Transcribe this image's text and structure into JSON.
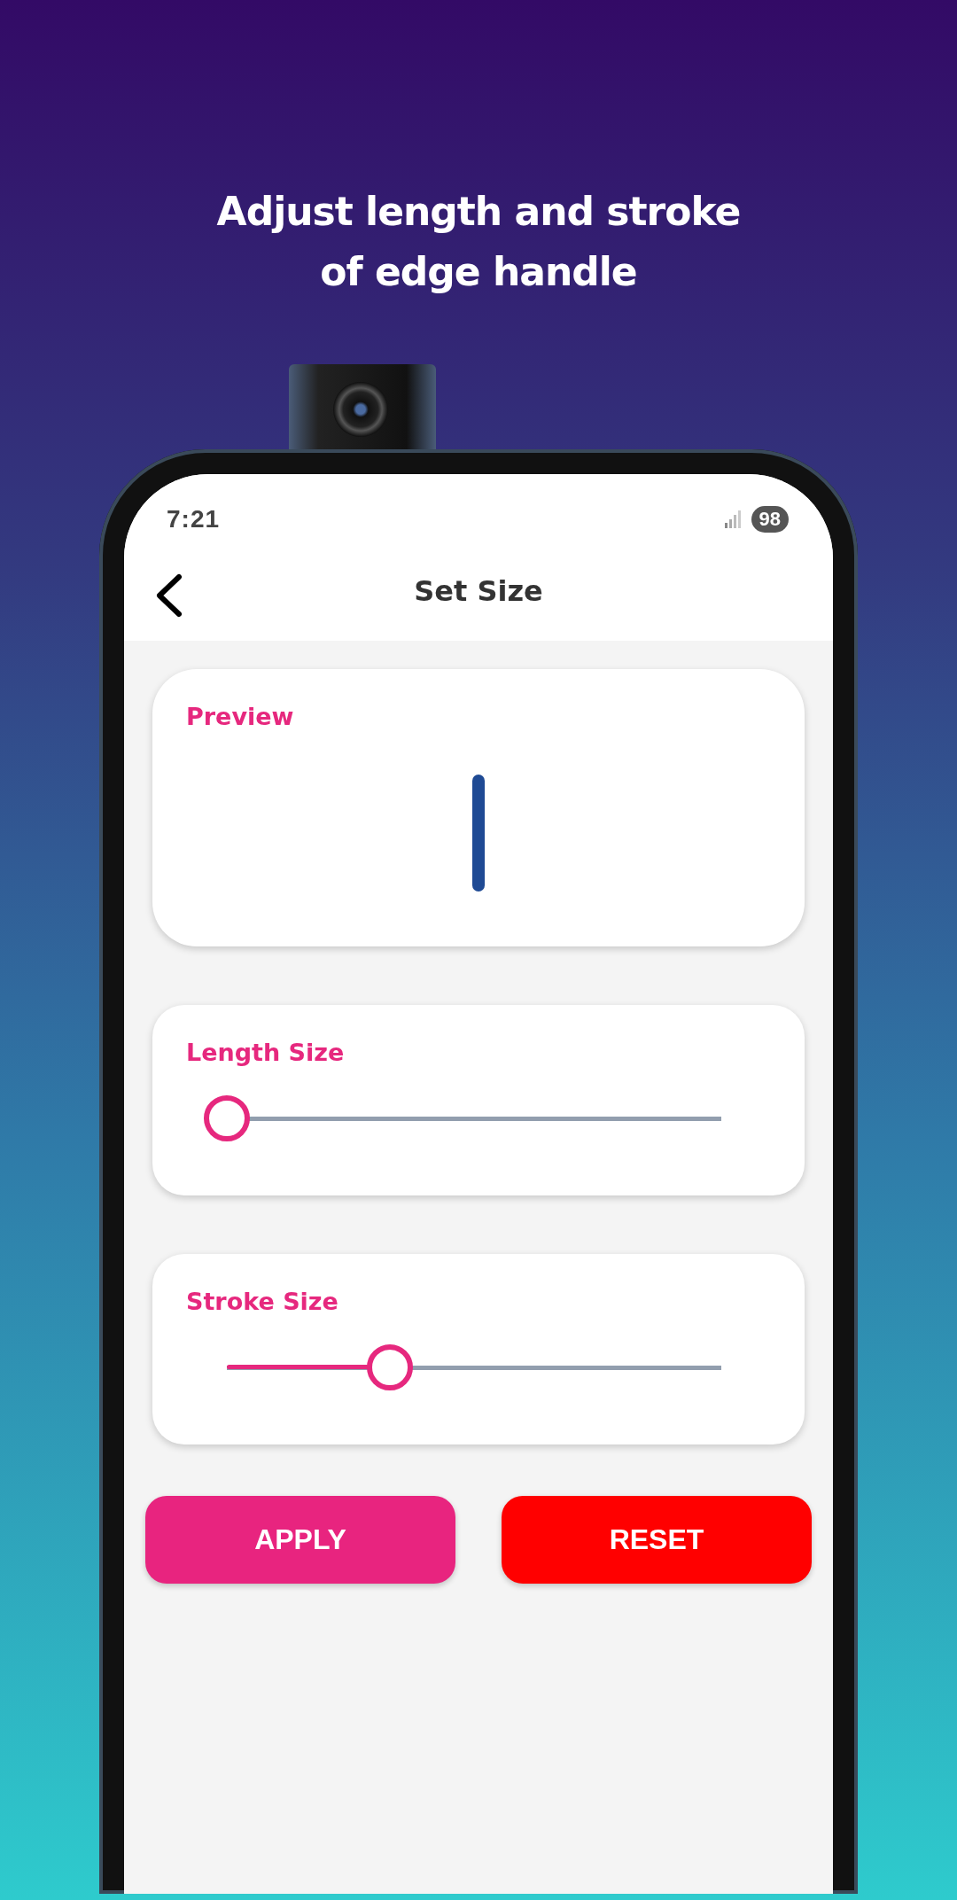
{
  "headline": "Adjust length and stroke\nof edge handle",
  "status_bar": {
    "time": "7:21",
    "battery": "98"
  },
  "header": {
    "title": "Set Size"
  },
  "preview": {
    "label": "Preview"
  },
  "sliders": [
    {
      "label": "Length Size",
      "level": 0
    },
    {
      "label": "Stroke Size",
      "level": 0.33
    }
  ],
  "buttons": [
    {
      "label": "APPLY",
      "kind": "apply"
    },
    {
      "label": "RESET",
      "kind": "reset"
    }
  ]
}
